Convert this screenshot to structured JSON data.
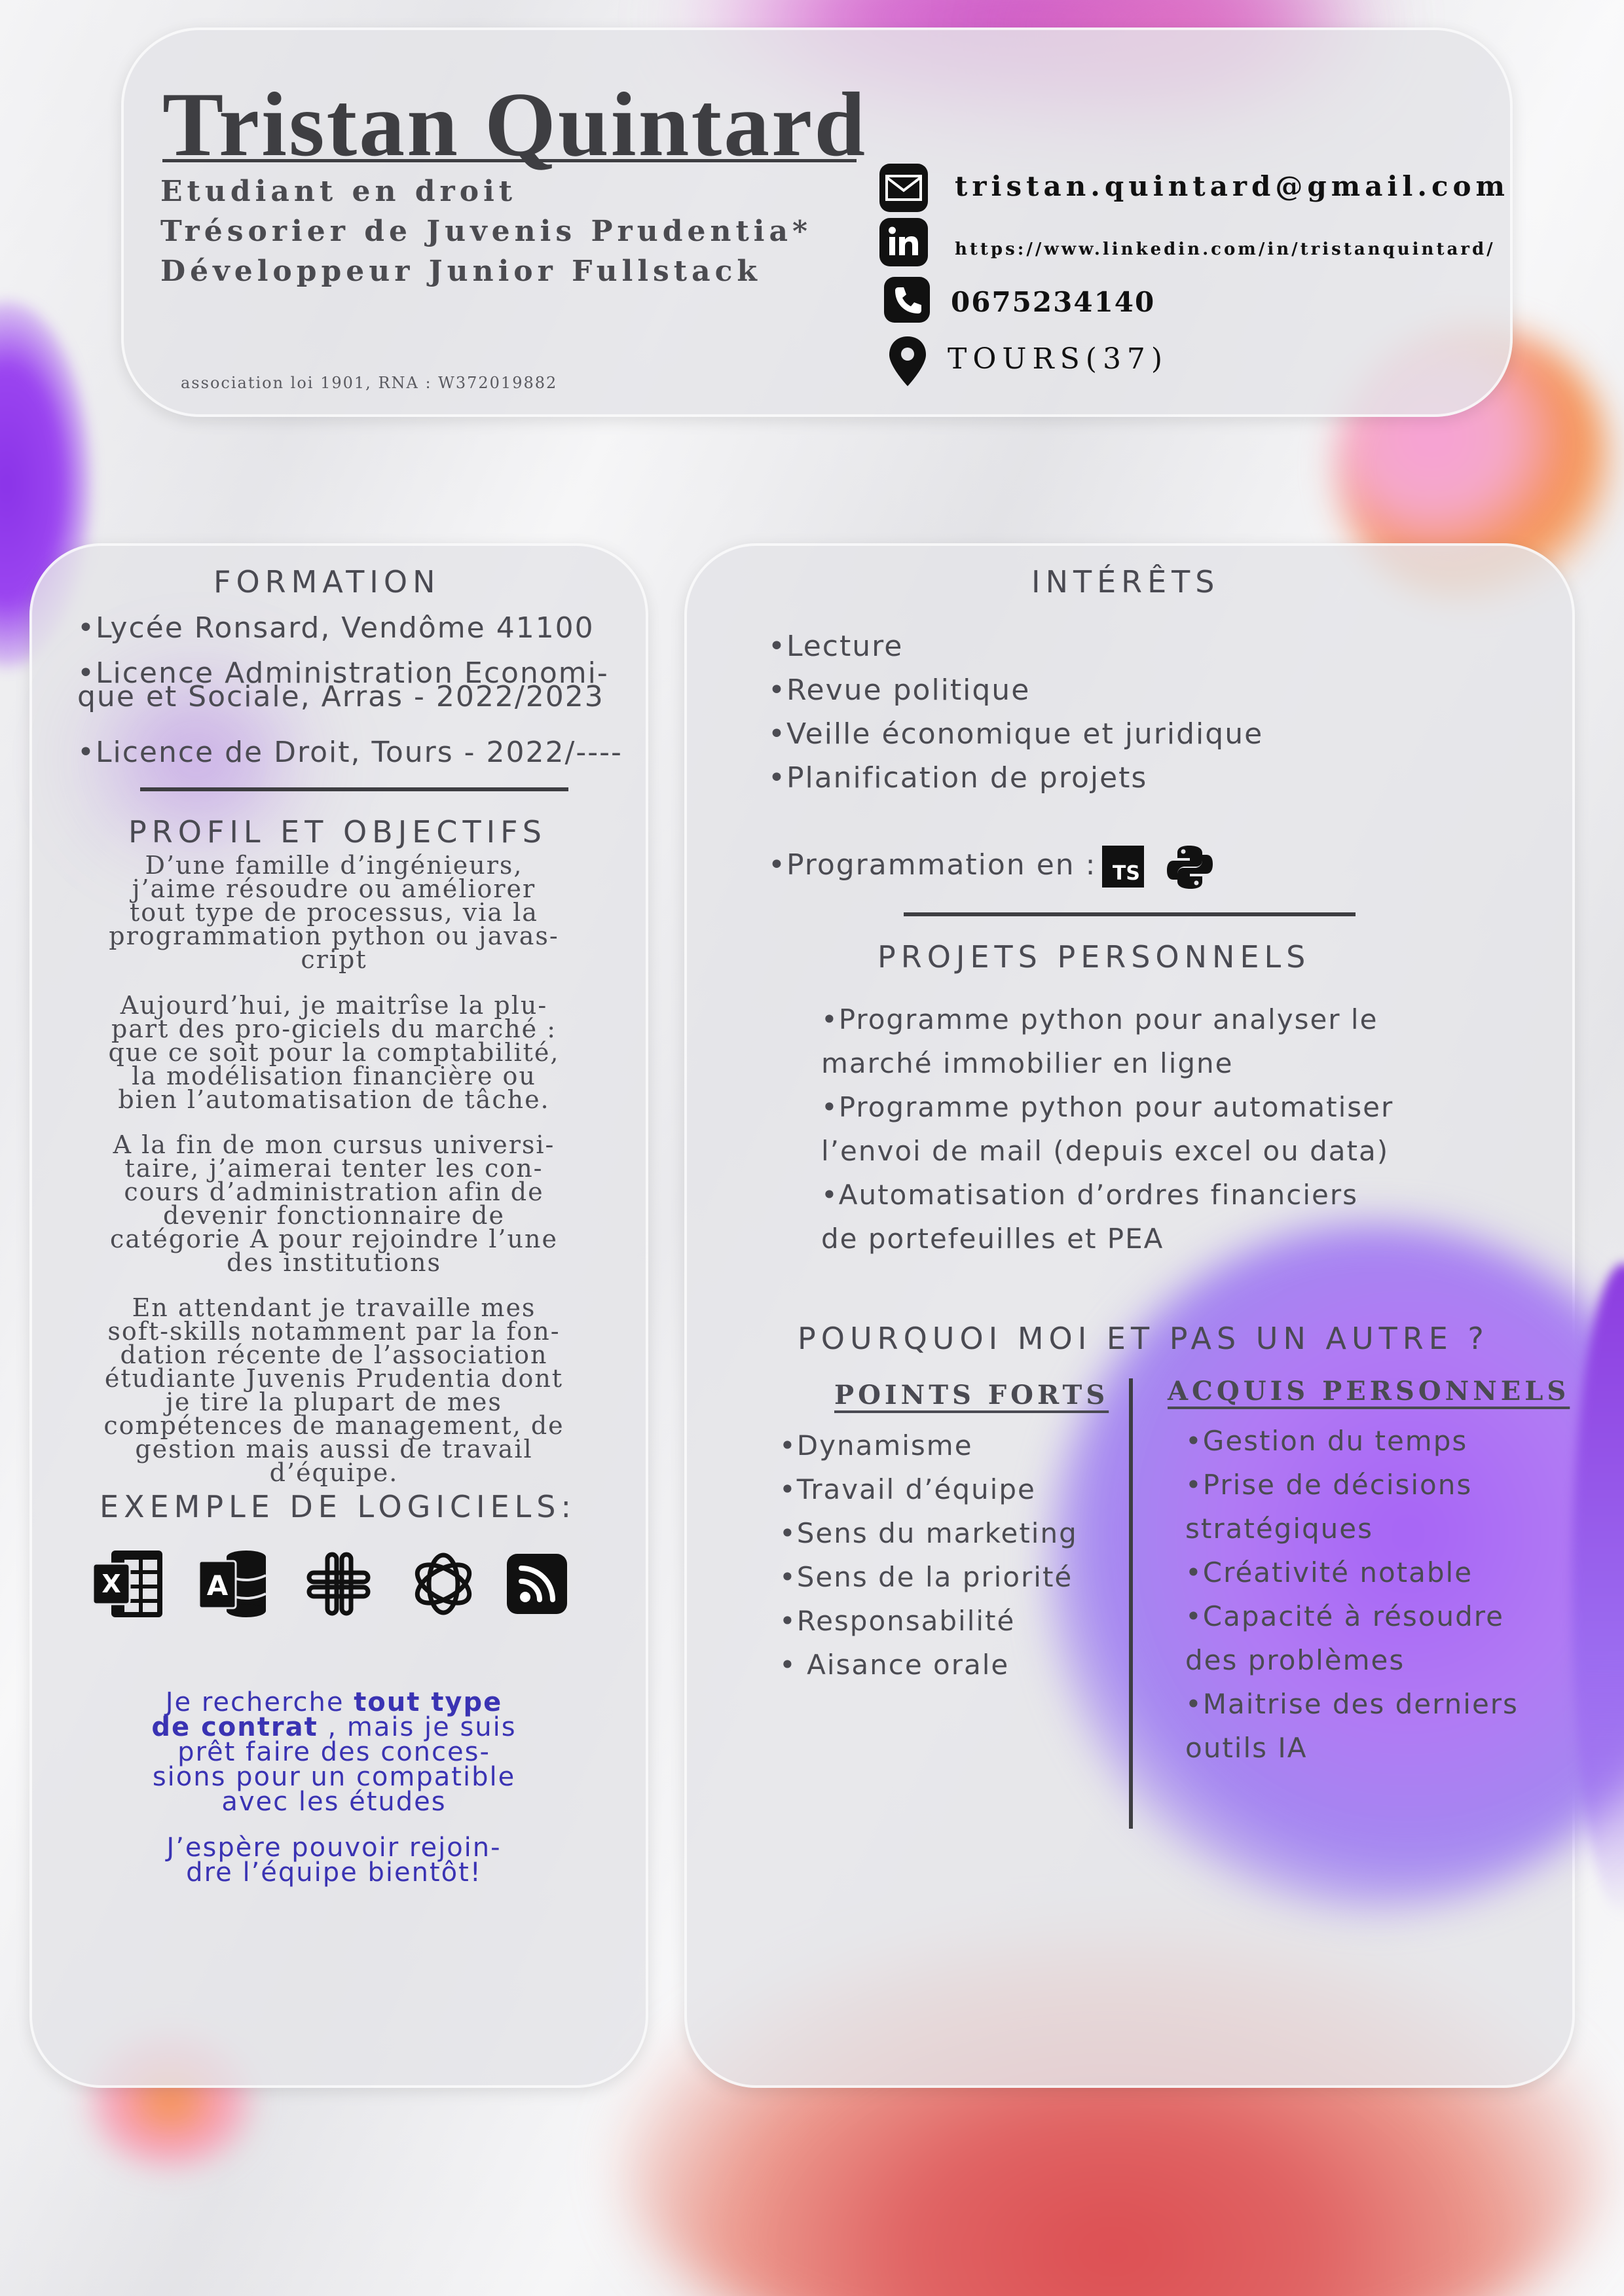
{
  "header": {
    "name": "Tristan Quintard",
    "roles": [
      "Etudiant en droit",
      "Trésorier de Juvenis Prudentia*",
      "Développeur Junior Fullstack"
    ],
    "footnote": "association loi 1901, RNA : W372019882"
  },
  "contact": {
    "email": "tristan.quintard@gmail.com",
    "linkedin": "https://www.linkedin.com/in/tristanquintard/",
    "phone": "0675234140",
    "location": "TOURS(37)",
    "icons": [
      "mail-icon",
      "linkedin-icon",
      "phone-icon",
      "location-pin-icon"
    ]
  },
  "formation": {
    "title": "FORMATION",
    "items": [
      "•Lycée  Ronsard,  Vendôme  41100",
      [
        "•Licence Administration Economi-",
        "que et Sociale, Arras - 2022/2023"
      ],
      "•Licence de Droit, Tours - 2022/----"
    ]
  },
  "profil": {
    "title": "PROFIL ET OBJECTIFS",
    "paragraphs": [
      [
        "D’une famille d’ingénieurs,",
        "j’aime résoudre ou améliorer",
        "tout type de processus, via la",
        "programmation python ou javas-",
        "cript"
      ],
      [
        "Aujourd’hui, je maitrîse la plu-",
        "part des pro-giciels du marché :",
        "que ce soit pour la comptabilité,",
        "la modélisation financière ou",
        "bien l’automatisation de tâche."
      ],
      [
        "A la fin de mon cursus universi-",
        "taire, j’aimerai tenter les con-",
        "cours d’administration afin de",
        "devenir fonctionnaire de",
        "catégorie A pour rejoindre l’une",
        "des institutions"
      ],
      [
        "En attendant je travaille mes",
        "soft-skills notamment par la fon-",
        "dation récente de l’association",
        "étudiante Juvenis Prudentia dont",
        "je tire la plupart de mes",
        "compétences de management, de",
        "gestion mais aussi de travail",
        "d’équipe."
      ]
    ]
  },
  "logiciels": {
    "title": "EXEMPLE DE LOGICIELS:",
    "icons": [
      "excel-icon",
      "access-icon",
      "slack-icon",
      "chatgpt-icon",
      "rss-icon"
    ],
    "icon_letters": [
      "X",
      "A"
    ]
  },
  "closing": {
    "line1_pre": "Je recherche ",
    "line1_bold": "tout type",
    "line2_bold": "de contrat",
    "line2_rest": " , mais je suis",
    "lines": [
      "prêt faire des conces-",
      "sions pour un compatible",
      "avec les études"
    ],
    "hope": [
      "J’espère pouvoir rejoin-",
      "dre l’équipe bientôt!"
    ]
  },
  "interets": {
    "title": "INTÉRÊTS",
    "items": [
      "•Lecture",
      "•Revue politique",
      "•Veille économique et juridique",
      "•Planification de projets"
    ],
    "programming": "•Programmation en :",
    "ts_label": "TS",
    "lang_icons": [
      "typescript-icon",
      "python-icon"
    ]
  },
  "projets": {
    "title": "PROJETS PERSONNELS",
    "lines": [
      "•Programme python pour analyser le",
      "marché immobilier en ligne",
      "•Programme python pour automatiser",
      "l’envoi de mail (depuis excel ou data)",
      "•Automatisation  d’ordres  financiers",
      "de portefeuilles et PEA"
    ]
  },
  "pourquoi": {
    "title": "POURQUOI MOI ET PAS UN AUTRE ?",
    "forts_title": "POINTS FORTS",
    "forts": [
      "•Dynamisme",
      "•Travail d’équipe",
      "•Sens du marketing",
      "•Sens de la priorité",
      "•Responsabilité",
      "• Aisance orale"
    ],
    "acquis_title": "ACQUIS PERSONNELS",
    "acquis": [
      "•Gestion du temps",
      "•Prise    de    décisions",
      "stratégiques",
      "•Créativité notable",
      "•Capacité  à  résoudre",
      "des problèmes",
      "•Maitrise  des  derniers",
      "outils IA"
    ]
  },
  "colors": {
    "text": "#4a4a52",
    "accent_blue": "#3a33b3",
    "purple": "#a764f5",
    "pink": "#c94fc0",
    "red": "#dc4e52",
    "orange": "#f58f4a"
  }
}
